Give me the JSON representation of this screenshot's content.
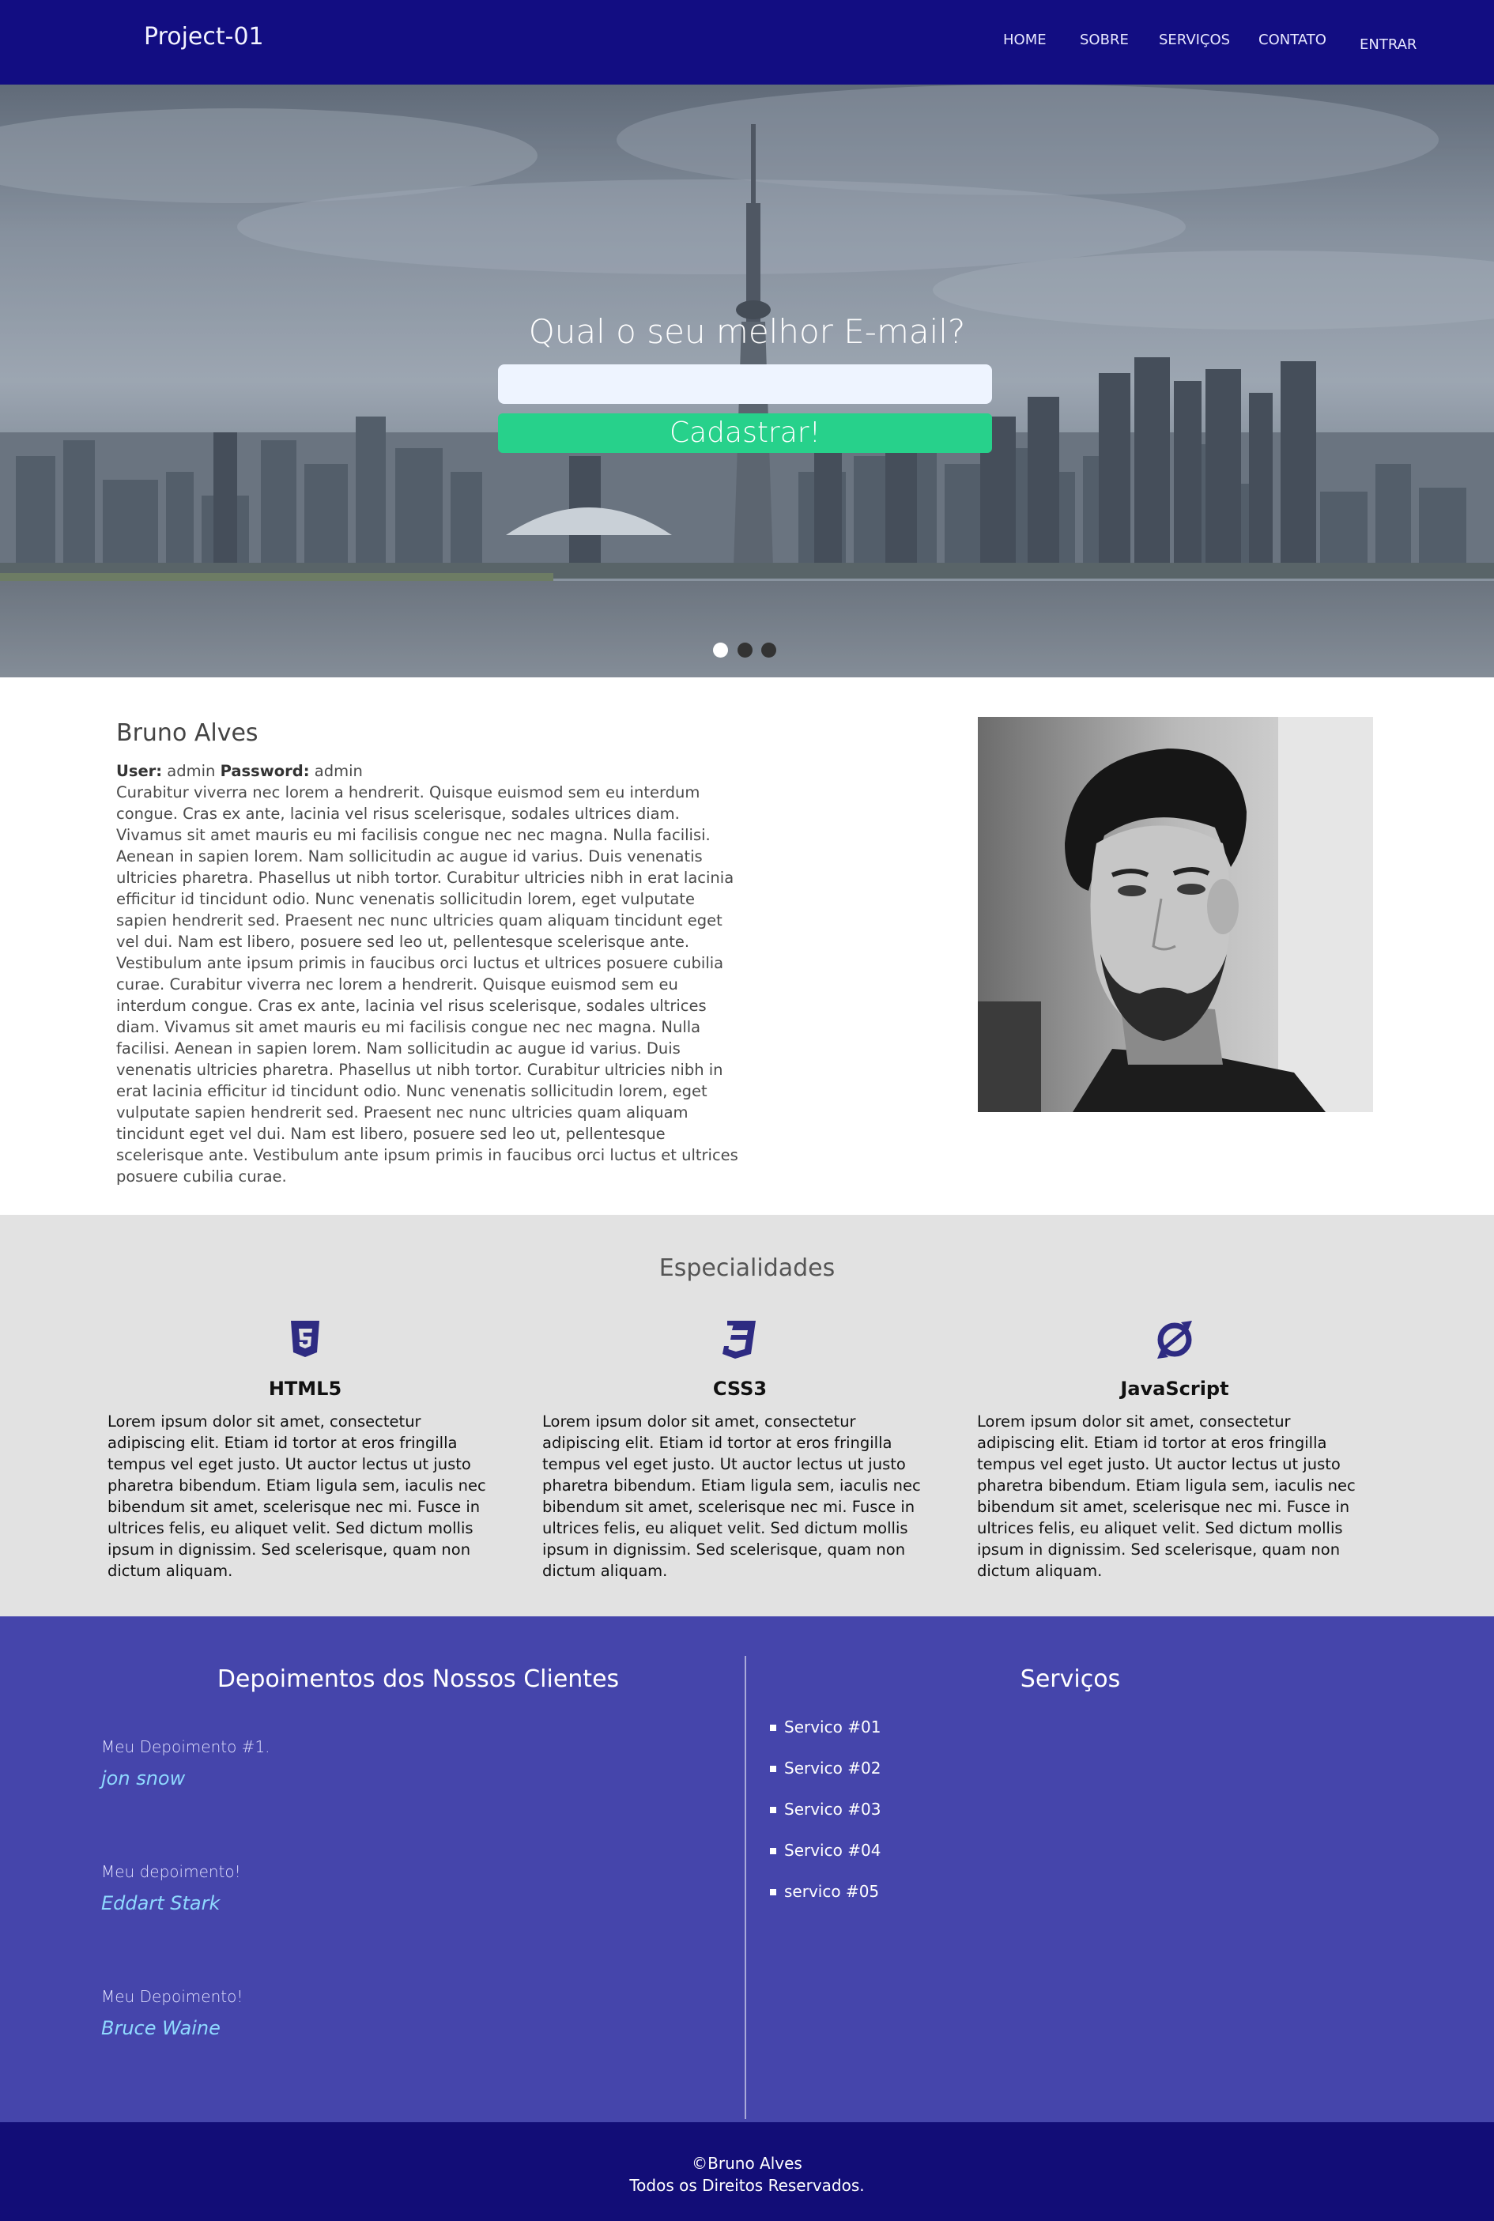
{
  "header": {
    "logo": "Project-01",
    "nav": [
      "HOME",
      "SOBRE",
      "SERVIÇOS",
      "CONTATO",
      "ENTRAR"
    ]
  },
  "hero": {
    "title": "Qual o seu melhor E-mail?",
    "email_value": "",
    "submit_label": "Cadastrar!",
    "slides": 3,
    "active_slide": 1
  },
  "about": {
    "name": "Bruno Alves",
    "user_label": "User:",
    "user_value": "admin",
    "password_label": "Password:",
    "password_value": "admin",
    "text": "Curabitur viverra nec lorem a hendrerit. Quisque euismod sem eu interdum congue. Cras ex ante, lacinia vel risus scelerisque, sodales ultrices diam. Vivamus sit amet mauris eu mi facilisis congue nec nec magna. Nulla facilisi. Aenean in sapien lorem. Nam sollicitudin ac augue id varius. Duis venenatis ultricies pharetra. Phasellus ut nibh tortor. Curabitur ultricies nibh in erat lacinia efficitur id tincidunt odio. Nunc venenatis sollicitudin lorem, eget vulputate sapien hendrerit sed. Praesent nec nunc ultricies quam aliquam tincidunt eget vel dui. Nam est libero, posuere sed leo ut, pellentesque scelerisque ante. Vestibulum ante ipsum primis in faucibus orci luctus et ultrices posuere cubilia curae. Curabitur viverra nec lorem a hendrerit. Quisque euismod sem eu interdum congue. Cras ex ante, lacinia vel risus scelerisque, sodales ultrices diam. Vivamus sit amet mauris eu mi facilisis congue nec nec magna. Nulla facilisi. Aenean in sapien lorem. Nam sollicitudin ac augue id varius. Duis venenatis ultricies pharetra. Phasellus ut nibh tortor. Curabitur ultricies nibh in erat lacinia efficitur id tincidunt odio. Nunc venenatis sollicitudin lorem, eget vulputate sapien hendrerit sed. Praesent nec nunc ultricies quam aliquam tincidunt eget vel dui. Nam est libero, posuere sed leo ut, pellentesque scelerisque ante. Vestibulum ante ipsum primis in faucibus orci luctus et ultrices posuere cubilia curae."
  },
  "specialties": {
    "title": "Especialidades",
    "items": [
      {
        "icon": "html5-icon",
        "name": "HTML5",
        "text": "Lorem ipsum dolor sit amet, consectetur adipiscing elit. Etiam id tortor at eros fringilla tempus vel eget justo. Ut auctor lectus ut justo pharetra bibendum. Etiam ligula sem, iaculis nec bibendum sit amet, scelerisque nec mi. Fusce in ultrices felis, eu aliquet velit. Sed dictum mollis ipsum in dignissim. Sed scelerisque, quam non dictum aliquam."
      },
      {
        "icon": "css3-icon",
        "name": "CSS3",
        "text": "Lorem ipsum dolor sit amet, consectetur adipiscing elit. Etiam id tortor at eros fringilla tempus vel eget justo. Ut auctor lectus ut justo pharetra bibendum. Etiam ligula sem, iaculis nec bibendum sit amet, scelerisque nec mi. Fusce in ultrices felis, eu aliquet velit. Sed dictum mollis ipsum in dignissim. Sed scelerisque, quam non dictum aliquam."
      },
      {
        "icon": "javascript-icon",
        "name": "JavaScript",
        "text": "Lorem ipsum dolor sit amet, consectetur adipiscing elit. Etiam id tortor at eros fringilla tempus vel eget justo. Ut auctor lectus ut justo pharetra bibendum. Etiam ligula sem, iaculis nec bibendum sit amet, scelerisque nec mi. Fusce in ultrices felis, eu aliquet velit. Sed dictum mollis ipsum in dignissim. Sed scelerisque, quam non dictum aliquam."
      }
    ]
  },
  "testimonials": {
    "title": "Depoimentos dos Nossos Clientes",
    "items": [
      {
        "text": "Meu Depoimento #1.",
        "author": "jon snow"
      },
      {
        "text": "Meu depoimento!",
        "author": "Eddart Stark"
      },
      {
        "text": "Meu Depoimento!",
        "author": "Bruce Waine"
      }
    ]
  },
  "services": {
    "title": "Serviços",
    "items": [
      "Servico #01",
      "Servico #02",
      "Servico #03",
      "Servico #04",
      "servico #05"
    ]
  },
  "footer": {
    "line1": "©Bruno Alves",
    "line2": "Todos os Direitos Reservados."
  },
  "colors": {
    "header": "#120d82",
    "button": "#27d18b",
    "specialties_bg": "#e2e2e2",
    "testimonials_bg": "#4545ab",
    "author": "#8fd9ff",
    "icons": "#2e2b82"
  }
}
